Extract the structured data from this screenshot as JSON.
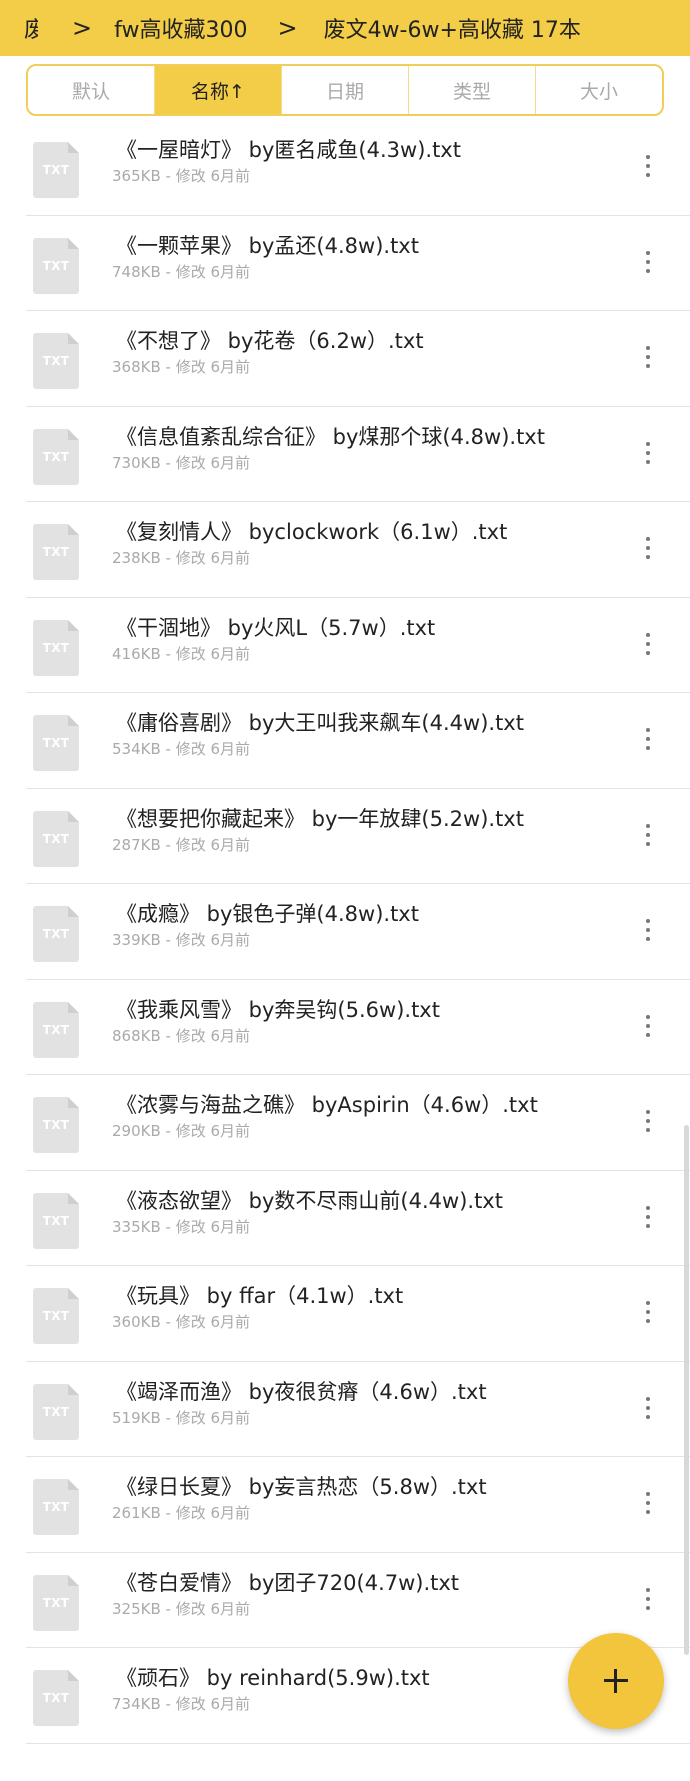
{
  "breadcrumb": {
    "partial": "废",
    "folder": "fw高收藏300",
    "current": "废文4w-6w+高收藏 17本",
    "separator": ">"
  },
  "sort_tabs": [
    {
      "label": "默认",
      "active": false
    },
    {
      "label": "名称↑",
      "active": true
    },
    {
      "label": "日期",
      "active": false
    },
    {
      "label": "类型",
      "active": false
    },
    {
      "label": "大小",
      "active": false
    }
  ],
  "file_icon_label": "TXT",
  "files": [
    {
      "name": "《一屋暗灯》 by匿名咸鱼(4.3w).txt",
      "meta": "365KB - 修改 6月前"
    },
    {
      "name": "《一颗苹果》 by孟还(4.8w).txt",
      "meta": "748KB - 修改 6月前"
    },
    {
      "name": "《不想了》 by花卷（6.2w）.txt",
      "meta": "368KB - 修改 6月前"
    },
    {
      "name": "《信息值紊乱综合征》 by煤那个球(4.8w).txt",
      "meta": "730KB - 修改 6月前"
    },
    {
      "name": "《复刻情人》 byclockwork（6.1w）.txt",
      "meta": "238KB - 修改 6月前"
    },
    {
      "name": "《干涸地》 by火风L（5.7w）.txt",
      "meta": "416KB - 修改 6月前"
    },
    {
      "name": "《庸俗喜剧》 by大王叫我来飙车(4.4w).txt",
      "meta": "534KB - 修改 6月前"
    },
    {
      "name": "《想要把你藏起来》 by一年放肆(5.2w).txt",
      "meta": "287KB - 修改 6月前"
    },
    {
      "name": "《成瘾》 by银色子弹(4.8w).txt",
      "meta": "339KB - 修改 6月前"
    },
    {
      "name": "《我乘风雪》 by奔吴钩(5.6w).txt",
      "meta": "868KB - 修改 6月前"
    },
    {
      "name": "《浓雾与海盐之礁》 byAspirin（4.6w）.txt",
      "meta": "290KB - 修改 6月前"
    },
    {
      "name": "《液态欲望》 by数不尽雨山前(4.4w).txt",
      "meta": "335KB - 修改 6月前"
    },
    {
      "name": "《玩具》 by ffar（4.1w）.txt",
      "meta": "360KB - 修改 6月前"
    },
    {
      "name": "《竭泽而渔》 by夜很贫瘠（4.6w）.txt",
      "meta": "519KB - 修改 6月前"
    },
    {
      "name": "《绿日长夏》 by妄言热恋（5.8w）.txt",
      "meta": "261KB - 修改 6月前"
    },
    {
      "name": "《苍白爱情》 by团子720(4.7w).txt",
      "meta": "325KB - 修改 6月前"
    },
    {
      "name": "《顽石》 by reinhard(5.9w).txt",
      "meta": "734KB - 修改 6月前"
    }
  ],
  "colors": {
    "accent": "#f3cd47",
    "fab": "#f3c53c",
    "meta_text": "#aaaaaa",
    "divider": "#e3e3e3"
  },
  "icons": {
    "breadcrumb_separator": "chevron-right-icon",
    "file": "txt-file-icon",
    "row_menu": "more-vertical-icon",
    "fab": "plus-icon"
  }
}
